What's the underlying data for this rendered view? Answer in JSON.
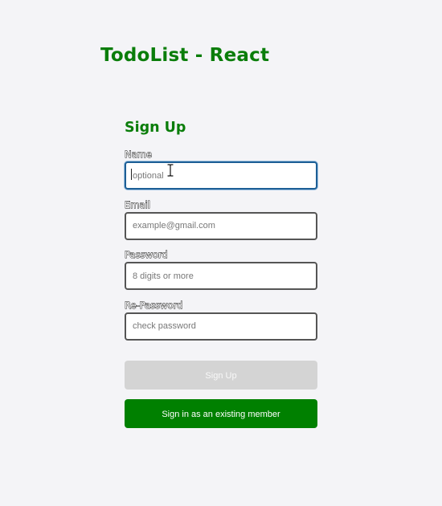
{
  "header": {
    "title": "TodoList - React"
  },
  "signup_form": {
    "title": "Sign Up",
    "fields": [
      {
        "label": "Name",
        "placeholder": "optional",
        "value": ""
      },
      {
        "label": "Email",
        "placeholder": "example@gmail.com",
        "value": ""
      },
      {
        "label": "Password",
        "placeholder": "8 digits or more",
        "value": ""
      },
      {
        "label": "Re-Password",
        "placeholder": "check password",
        "value": ""
      }
    ],
    "signup_button_label": "Sign Up",
    "signin_button_label": "Sign in as an existing member"
  },
  "colors": {
    "brand_green": "#0a7d0a",
    "primary_button": "#008000",
    "disabled_button": "#d4d4d4",
    "focus_border": "#1d5f96",
    "background": "#f4f4f7"
  },
  "icons": {
    "cursor": "ibeam-cursor-icon"
  }
}
